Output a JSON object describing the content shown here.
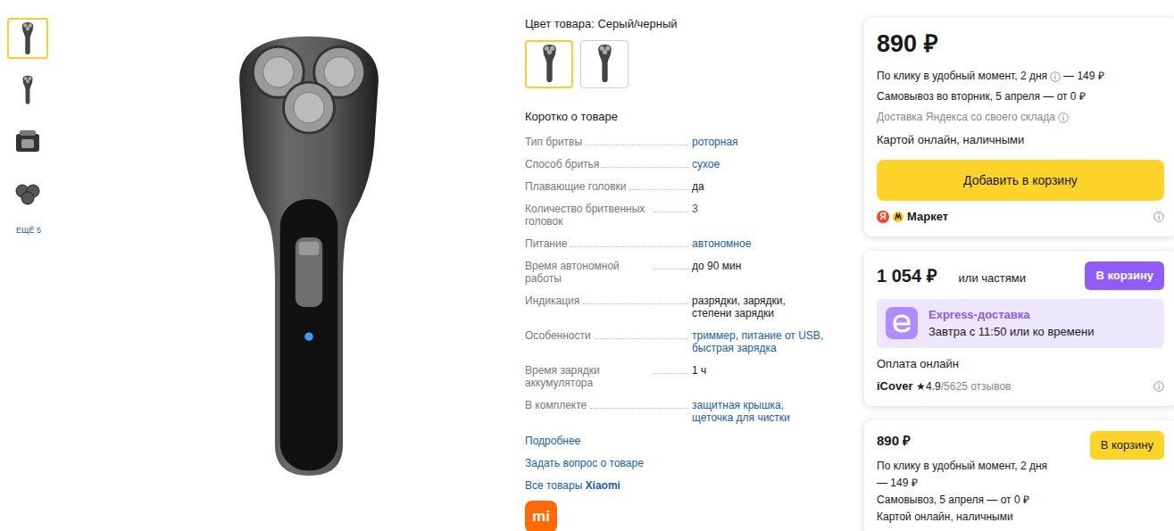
{
  "gallery": {
    "thumbnails": [
      {
        "selected": true
      },
      {
        "selected": false
      },
      {
        "selected": false
      },
      {
        "selected": false
      }
    ],
    "more": "ЕЩЁ 5"
  },
  "color": {
    "label": "Цвет товара:",
    "value": "Серый/черный",
    "options": [
      {
        "selected": true
      },
      {
        "selected": false
      }
    ]
  },
  "summary": {
    "title": "Коротко о товаре",
    "specs": [
      {
        "name": "Тип бритвы",
        "value": "роторная",
        "link": true
      },
      {
        "name": "Способ бритья",
        "value": "сухое",
        "link": true
      },
      {
        "name": "Плавающие головки",
        "value": "да",
        "link": false
      },
      {
        "name": "Количество бритвенных головок",
        "value": "3",
        "link": true
      },
      {
        "name": "Питание",
        "value": "автономное",
        "link": true
      },
      {
        "name": "Время автономной работы",
        "value": "до 90 мин",
        "link": false
      },
      {
        "name": "Индикация",
        "value": "разрядки, зарядки, степени зарядки",
        "link": false
      },
      {
        "name": "Особенности",
        "value": "триммер, питание от USB, быстрая зарядка",
        "link": true
      },
      {
        "name": "Время зарядки аккумулятора",
        "value": "1 ч",
        "link": false
      },
      {
        "name": "В комплекте",
        "value": "защитная крышка, щеточка для чистки",
        "link": true
      }
    ]
  },
  "links": [
    "Подробнее",
    "Задать вопрос о товаре"
  ],
  "brand_link": {
    "prefix": "Все товары",
    "brand": "Xiaomi"
  },
  "brand_logo": "mi",
  "offers": [
    {
      "kind": "market",
      "price": "890 ₽",
      "lines": [
        {
          "text": "По клику в удобный момент, 2 дня",
          "info": true,
          "suffix": "— 149 ₽",
          "grey": false
        },
        {
          "text": "Самовывоз во вторник, 5 апреля — от 0 ₽",
          "info": false,
          "suffix": "",
          "grey": false
        },
        {
          "text": "Доставка Яндекса со своего склада",
          "info": true,
          "suffix": "",
          "grey": true
        }
      ],
      "payment": "Картой онлайн, наличными",
      "button": "Добавить в корзину",
      "seller_logo": {
        "mark": "Я",
        "text": "Маркет"
      }
    },
    {
      "kind": "express",
      "price": "1 054 ₽",
      "parts": "или частями",
      "button": "В корзину",
      "express_title": "Express-доставка",
      "express_text": "Завтра с 11:50 или ко времени",
      "payment": "Оплата онлайн",
      "seller": "iCover",
      "star": "★",
      "rating": "4.9",
      "reviews": "/5625 отзывов"
    },
    {
      "kind": "compact",
      "price": "890 ₽",
      "button": "В корзину",
      "lines": [
        "По клику в удобный момент, 2 дня — 149 ₽",
        "Самовывоз, 5 апреля — от 0 ₽",
        "Картой онлайн, наличными"
      ]
    }
  ]
}
